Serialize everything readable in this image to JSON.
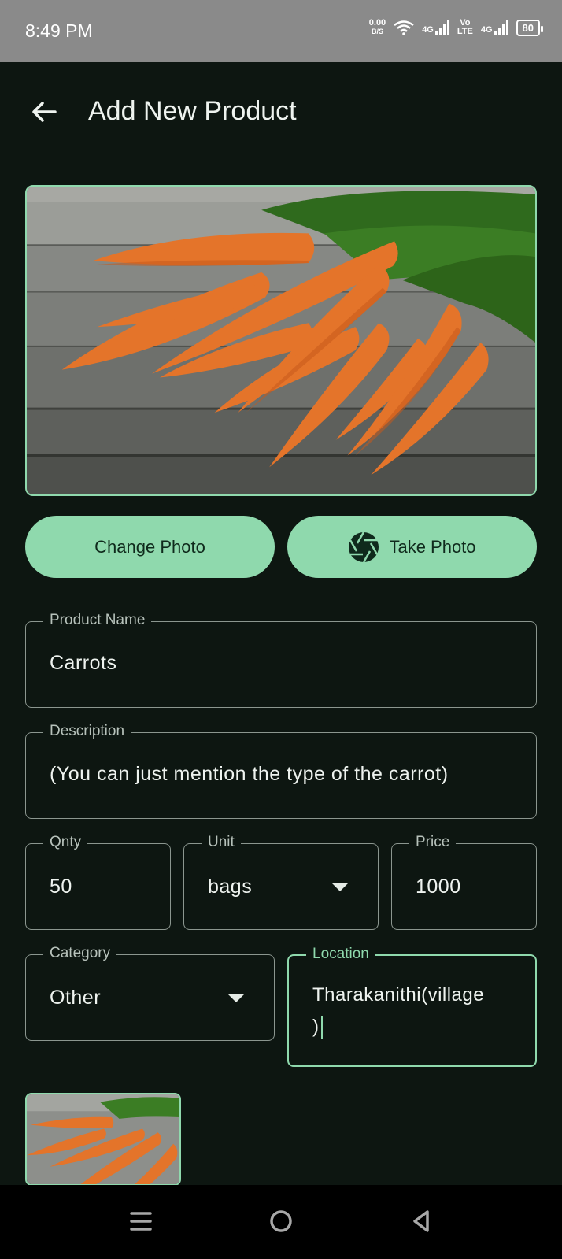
{
  "status": {
    "time": "8:49 PM",
    "netspeed_value": "0.00",
    "netspeed_unit": "B/S",
    "sig1": "4G",
    "volte_top": "Vo",
    "volte_bottom": "LTE",
    "sig2": "4G",
    "battery": "80"
  },
  "header": {
    "title": "Add New Product"
  },
  "buttons": {
    "change_photo": "Change Photo",
    "take_photo": "Take Photo"
  },
  "fields": {
    "product_name": {
      "label": "Product Name",
      "value": "Carrots"
    },
    "description": {
      "label": "Description",
      "value": "(You can just mention the type of the carrot)"
    },
    "qnty": {
      "label": "Qnty",
      "value": "50"
    },
    "unit": {
      "label": "Unit",
      "value": "bags"
    },
    "price": {
      "label": "Price",
      "value": "1000"
    },
    "category": {
      "label": "Category",
      "value": "Other"
    },
    "location": {
      "label": "Location",
      "value_line1": "Tharakanithi(village",
      "value_line2": ")"
    }
  },
  "colors": {
    "accent": "#8fd9ad",
    "background": "#0d1611",
    "statusbar": "#8a8a8a"
  }
}
